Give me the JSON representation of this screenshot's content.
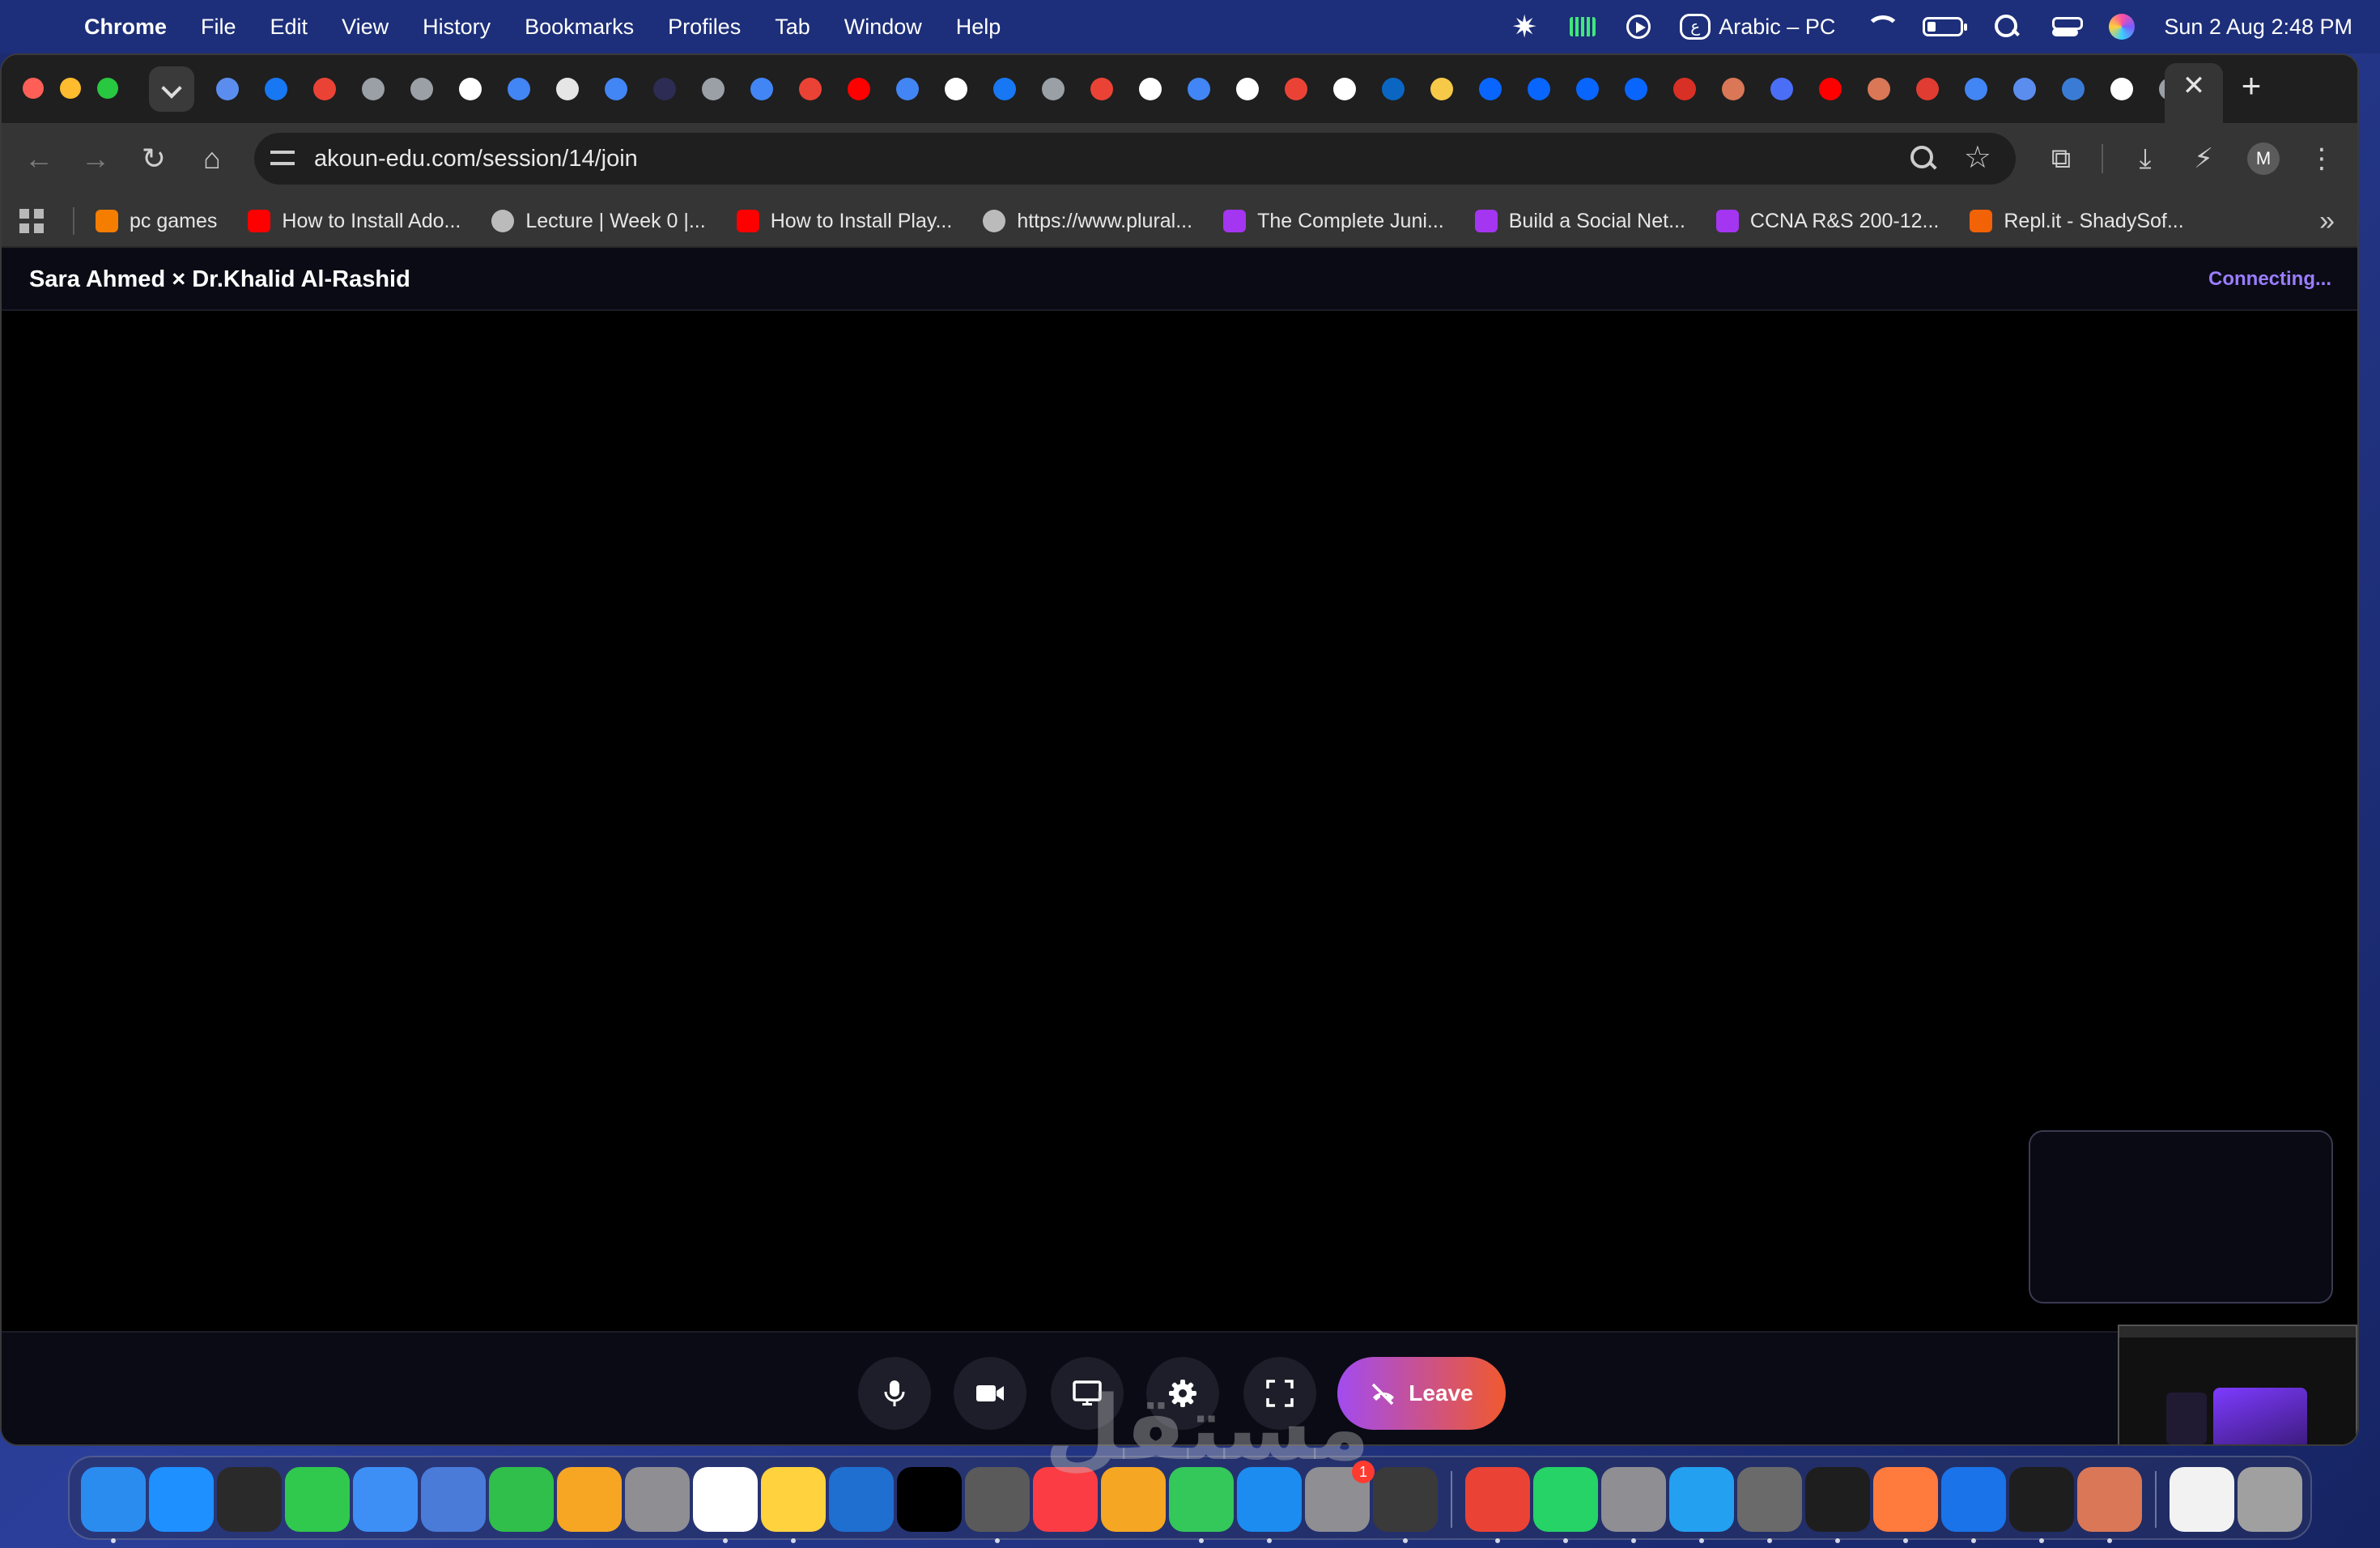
{
  "menubar": {
    "app_name": "Chrome",
    "menus": [
      "File",
      "Edit",
      "View",
      "History",
      "Bookmarks",
      "Profiles",
      "Tab",
      "Window",
      "Help"
    ],
    "input_source": "Arabic – PC",
    "datetime": "Sun 2 Aug  2:48 PM"
  },
  "browser": {
    "url": "akoun-edu.com/session/14/join",
    "profile_initial": "M",
    "bookmarks": [
      {
        "label": "pc games",
        "icon": "blogger-icon",
        "color": "#f57d00"
      },
      {
        "label": "How to Install Ado...",
        "icon": "youtube-icon",
        "color": "#ff0000"
      },
      {
        "label": "Lecture | Week 0 |...",
        "icon": "edx-icon",
        "color": "#bbbbbb"
      },
      {
        "label": "How to Install Play...",
        "icon": "youtube-icon",
        "color": "#ff0000"
      },
      {
        "label": "https://www.plural...",
        "icon": "globe-icon",
        "color": "#bbbbbb"
      },
      {
        "label": "The Complete Juni...",
        "icon": "udemy-icon",
        "color": "#a435f0"
      },
      {
        "label": "Build a Social Net...",
        "icon": "udemy-icon",
        "color": "#a435f0"
      },
      {
        "label": "CCNA R&S 200-12...",
        "icon": "udemy-icon",
        "color": "#a435f0"
      },
      {
        "label": "Repl.it - ShadySof...",
        "icon": "replit-icon",
        "color": "#f26207"
      }
    ]
  },
  "session": {
    "title": "Sara Ahmed × Dr.Khalid Al-Rashid",
    "status": "Connecting...",
    "leave_label": "Leave"
  },
  "colors": {
    "accent": "#9a7dff",
    "leave_gradient_start": "#a24bf0",
    "leave_gradient_end": "#f0592e",
    "tab_favicon_colors": [
      "#5b8def",
      "#1877f2",
      "#ea4335",
      "#9aa0a6",
      "#9aa0a6",
      "#ffffff",
      "#4285f4",
      "#e6e6e6",
      "#4285f4",
      "#2c2c54",
      "#9aa0a6",
      "#4285f4",
      "#ea4335",
      "#ff0000",
      "#4285f4",
      "#ffffff",
      "#1877f2",
      "#9aa0a6",
      "#ea4335",
      "#ffffff",
      "#4285f4",
      "#ffffff",
      "#ea4335",
      "#ffffff",
      "#0a66c2",
      "#f7c948",
      "#0866ff",
      "#0866ff",
      "#0866ff",
      "#0866ff",
      "#d93025",
      "#d97757",
      "#4a6ef5",
      "#ff0000",
      "#d97757",
      "#e03c31",
      "#4285f4",
      "#5b8def",
      "#3a7bd5",
      "#ffffff",
      "#9aa0a6"
    ],
    "dock_app_colors": [
      "#2b8cf0",
      "#1e90ff",
      "#2a2a2a",
      "#30c94d",
      "#3d8ff5",
      "#4a7bd8",
      "#2fbf4a",
      "#f6a623",
      "#8e8e93",
      "#ffffff",
      "#ffd23e",
      "#1f6fd1",
      "#000000",
      "#5a5a5a",
      "#fc3c44",
      "#f5a623",
      "#34c759",
      "#1c8cf0",
      "#8e8e93",
      "#3a3a3a",
      "#ea4335",
      "#25d366",
      "#8e8e93",
      "#23a0f0",
      "#6a6a6a",
      "#1e1e1e",
      "#ff7a3d",
      "#1a73e8",
      "#1e1e1e",
      "#d97757",
      "#f2f2f2",
      "#a0a0a0"
    ]
  }
}
